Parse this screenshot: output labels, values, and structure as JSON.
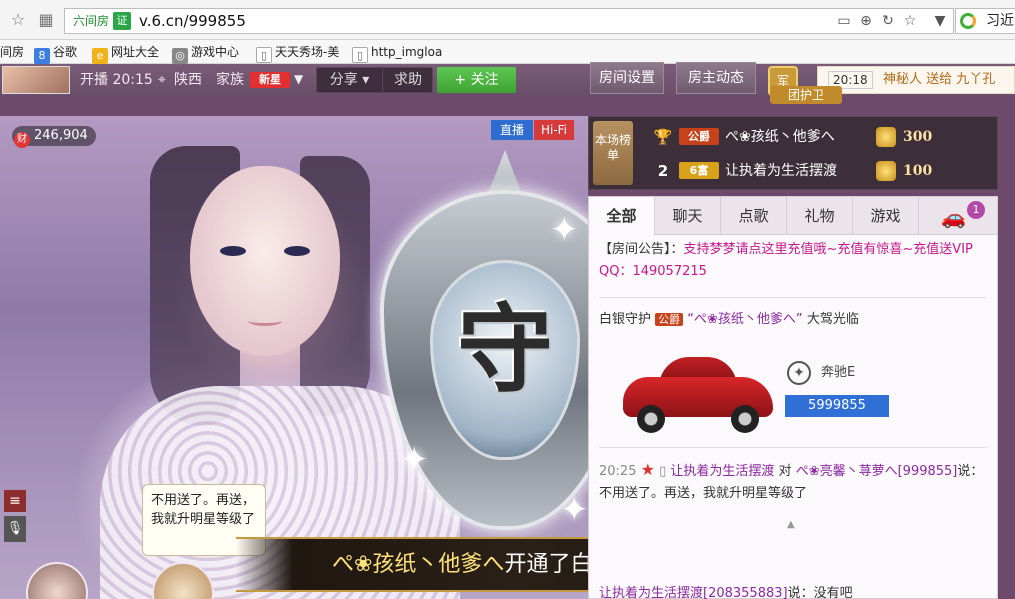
{
  "browser": {
    "site_tag": "六间房",
    "cert": "证",
    "url": "v.6.cn/999855",
    "search_text": "习近",
    "bookmarks": [
      "间房",
      "谷歌",
      "网址大全",
      "游戏中心",
      "天天秀场-美",
      "http_imgloa"
    ]
  },
  "header": {
    "live_time": "开播 20:15",
    "location": "陕西",
    "family_label": "家族",
    "family_badge": "新星",
    "share": "分享",
    "help": "求助",
    "follow": "+ 关注",
    "room_settings": "房间设置",
    "host_news": "房主动态",
    "guard_icon": "军",
    "guard_label": "团护卫",
    "ticker_time": "20:18",
    "ticker_text": "神秘人 送给 九丫孔"
  },
  "video": {
    "wealth": "246,904",
    "wealth_icon": "财",
    "live_tag": "直播",
    "hifi_tag": "Hi-Fi",
    "speech": "不用送了。再送，我就升明星等级了",
    "shield_glyph": "守",
    "banner_name": "ぺ❀孩纸丶他爹へ",
    "banner_text": "开通了白银守护！"
  },
  "rank": {
    "tab_label": "本场榜单",
    "rows": [
      {
        "num": "",
        "level": "公爵",
        "name": "ぺ❀孩纸丶他爹へ",
        "value": "300"
      },
      {
        "num": "2",
        "level": "6富",
        "name": "让执着为生活摆渡",
        "value": "100"
      }
    ]
  },
  "chat": {
    "tabs": [
      "全部",
      "聊天",
      "点歌",
      "礼物",
      "游戏"
    ],
    "car_count": "1",
    "notice_label": "【房间公告】：",
    "notice_text": "支持梦梦请点这里充值哦~充值有惊喜~充值送VIP QQ：149057215",
    "guard_msg_prefix": "白银守护",
    "guard_msg_level": "公爵",
    "guard_msg_name": "“ぺ❀孩纸丶他爹へ”",
    "guard_msg_suffix": "大驾光临",
    "car_name": "奔驰E",
    "car_number": "5999855",
    "msg_time": "20:25",
    "msg_user": "让执着为生活摆渡",
    "msg_to": "对",
    "msg_target": "ぺ❀亮馨丶荨萝へ[999855]",
    "msg_said": "说：",
    "msg_text": "不用送了。再送，我就升明星等级了",
    "next_user": "让执着为生活摆渡[208355883]",
    "next_said": "说：",
    "next_text": "没有吧"
  },
  "colors": {
    "follow": "#3ea332",
    "accent_pink": "#c8168c",
    "car_number_bg": "#2f6fd6",
    "banner_name": "#ffe27a"
  }
}
